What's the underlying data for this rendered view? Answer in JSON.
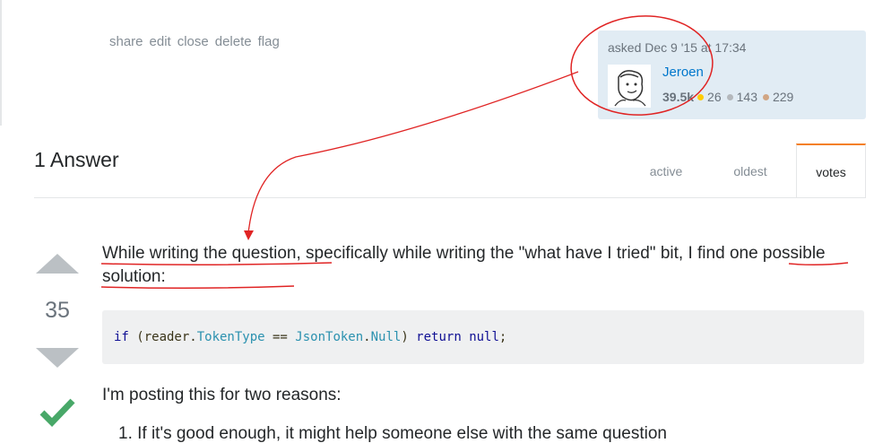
{
  "post_menu": {
    "items": [
      "share",
      "edit",
      "close",
      "delete",
      "flag"
    ]
  },
  "user_card": {
    "asked_time": "asked Dec 9 '15 at 17:34",
    "user_name": "Jeroen",
    "reputation": "39.5k",
    "badges": {
      "gold": "26",
      "silver": "143",
      "bronze": "229"
    },
    "colors": {
      "gold": "#ffcc01",
      "silver": "#b4b8bc",
      "bronze": "#d1a684"
    }
  },
  "answers": {
    "header": "1 Answer",
    "tabs": [
      "active",
      "oldest",
      "votes"
    ],
    "selected_tab": "votes"
  },
  "answer": {
    "vote_count": "35",
    "accepted": true,
    "para1_highlight1": "While writing the question",
    "para1_mid": ", specifically while writing the \"what have I tried\" bit, ",
    "para1_highlight2": "I find one possible solution",
    "para1_end": ":",
    "code": {
      "t1": "if",
      "t2": " (reader.",
      "t3": "TokenType",
      "t4": " == ",
      "t5": "JsonToken",
      "t6": ".",
      "t7": "Null",
      "t8": ") ",
      "t9": "return",
      "t10": " ",
      "t11": "null",
      "t12": ";"
    },
    "para2": "I'm posting this for two reasons:",
    "list_item_1": "1. If it's good enough, it might help someone else with the same question"
  },
  "annotation_color": "#e02424"
}
